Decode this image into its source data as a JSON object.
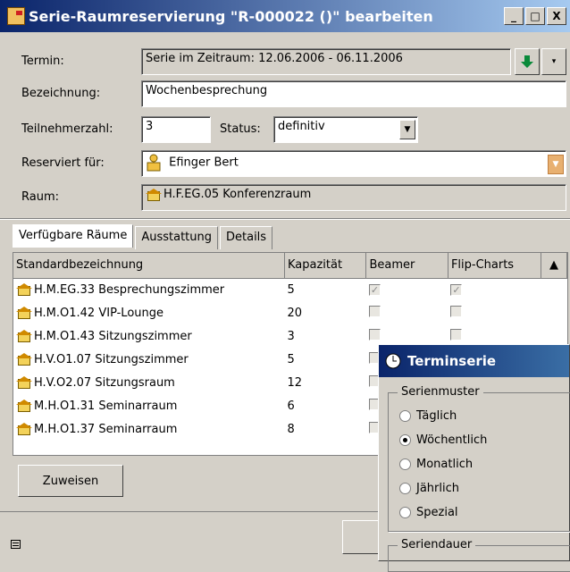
{
  "window": {
    "title": "Serie-Raumreservierung \"R-000022 ()\" bearbeiten"
  },
  "form": {
    "termin_label": "Termin:",
    "termin_value": "Serie im Zeitraum: 12.06.2006 - 06.11.2006",
    "bezeichnung_label": "Bezeichnung:",
    "bezeichnung_value": "Wochenbesprechung",
    "teilnehmer_label": "Teilnehmerzahl:",
    "teilnehmer_value": "3",
    "status_label": "Status:",
    "status_value": "definitiv",
    "reserviert_label": "Reserviert für:",
    "reserviert_value": "Efinger Bert",
    "raum_label": "Raum:",
    "raum_value": "H.F.EG.05  Konferenzraum"
  },
  "tabs": [
    "Verfügbare Räume",
    "Ausstattung",
    "Details"
  ],
  "table": {
    "headers": [
      "Standardbezeichnung",
      "Kapazität",
      "Beamer",
      "Flip-Charts"
    ],
    "rows": [
      {
        "name": "H.M.EG.33  Besprechungszimmer",
        "cap": "5"
      },
      {
        "name": "H.M.O1.42  VIP-Lounge",
        "cap": "20"
      },
      {
        "name": "H.M.O1.43  Sitzungszimmer",
        "cap": "3"
      },
      {
        "name": "H.V.O1.07  Sitzungszimmer",
        "cap": "5"
      },
      {
        "name": "H.V.O2.07  Sitzungsraum",
        "cap": "12"
      },
      {
        "name": "M.H.O1.31  Seminarraum",
        "cap": "6"
      },
      {
        "name": "M.H.O1.37  Seminarraum",
        "cap": "8"
      }
    ]
  },
  "buttons": {
    "zuweisen": "Zuweisen"
  },
  "popup": {
    "title": "Terminserie",
    "group1": "Serienmuster",
    "options": [
      "Täglich",
      "Wöchentlich",
      "Monatlich",
      "Jährlich",
      "Spezial"
    ],
    "group2": "Seriendauer"
  }
}
